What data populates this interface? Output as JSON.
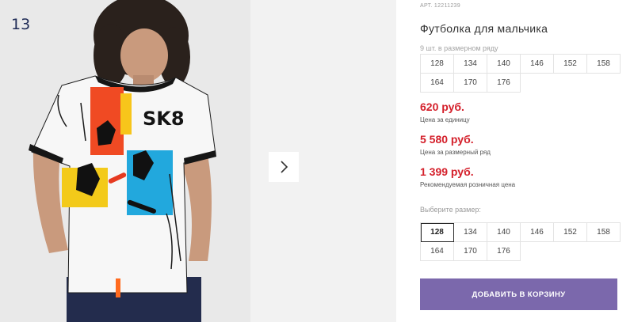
{
  "gallery": {
    "photo_index": "13",
    "next_icon": "chevron-right-icon"
  },
  "product": {
    "article": "АРТ. 12211239",
    "title": "Футболка для мальчика",
    "pack_note": "9 шт. в размерном ряду",
    "pack_sizes": [
      "128",
      "134",
      "140",
      "146",
      "152",
      "158",
      "164",
      "170",
      "176"
    ],
    "prices": [
      {
        "value": "620 руб.",
        "caption": "Цена за единицу"
      },
      {
        "value": "5 580 руб.",
        "caption": "Цена за размерный ряд"
      },
      {
        "value": "1 399 руб.",
        "caption": "Рекомендуемая розничная цена"
      }
    ],
    "choose_label": "Выберите размер:",
    "sizes": [
      "128",
      "134",
      "140",
      "146",
      "152",
      "158",
      "164",
      "170",
      "176"
    ],
    "selected_size": "128",
    "add_to_cart_label": "ДОБАВИТЬ В КОРЗИНУ"
  },
  "colors": {
    "price": "#d41f2a",
    "button": "#7b68ac"
  }
}
